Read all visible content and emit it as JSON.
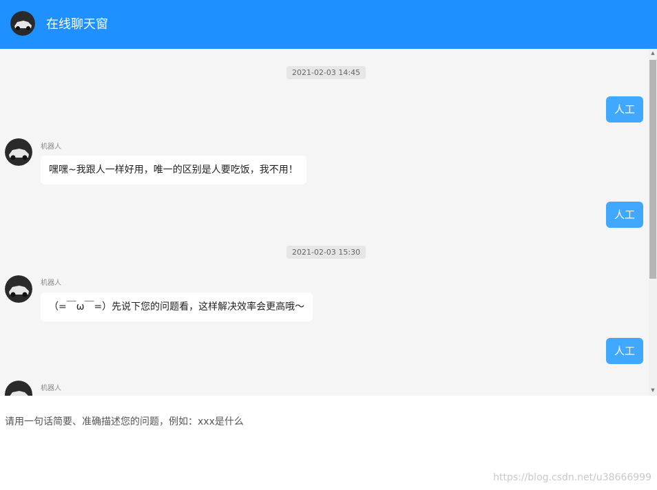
{
  "header": {
    "title": "在线聊天窗",
    "avatar_icon": "car-avatar-icon"
  },
  "chat": {
    "messages": [
      {
        "type": "time",
        "text": "2021-02-03 14:45"
      },
      {
        "type": "user",
        "text": "人工"
      },
      {
        "type": "bot",
        "name": "机器人",
        "text": "嘿嘿~我跟人一样好用，唯一的区别是人要吃饭，我不用！"
      },
      {
        "type": "user",
        "text": "人工"
      },
      {
        "type": "time",
        "text": "2021-02-03 15:30"
      },
      {
        "type": "bot",
        "name": "机器人",
        "text": "（=￣ω￣=）先说下您的问题看，这样解决效率会更高哦～"
      },
      {
        "type": "user",
        "text": "人工"
      },
      {
        "type": "bot",
        "name": "机器人",
        "text": ""
      }
    ]
  },
  "input": {
    "placeholder": "请用一句话简要、准确描述您的问题，例如：xxx是什么"
  },
  "watermark": "https://blog.csdn.net/u38666999",
  "colors": {
    "header": "#1e90ff",
    "user_bubble": "#40a9ff",
    "chat_background": "#f5f5f5"
  }
}
